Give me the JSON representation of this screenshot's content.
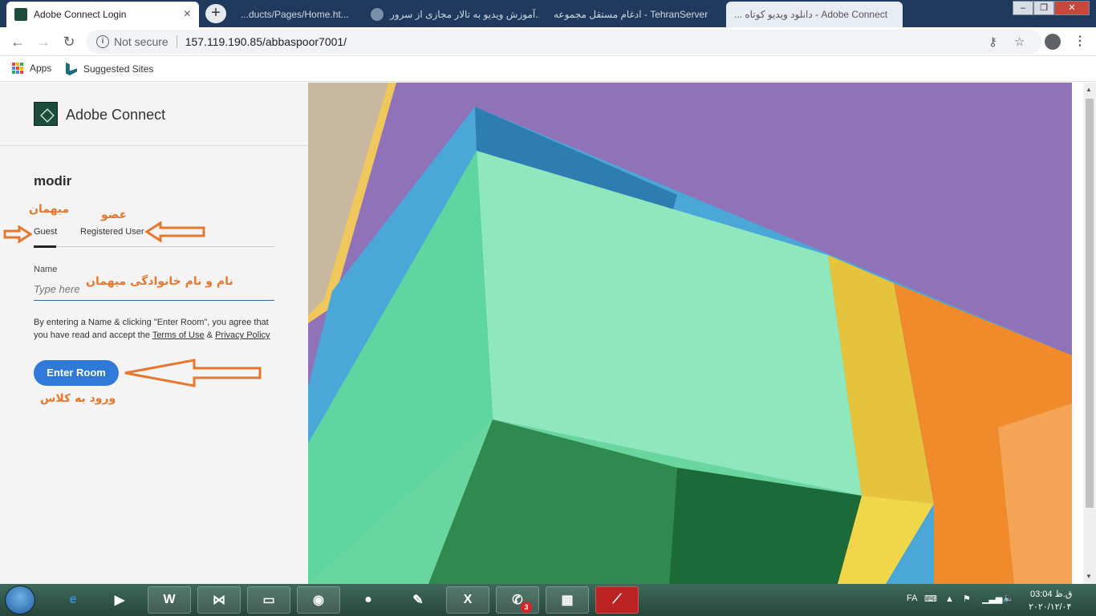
{
  "browser": {
    "active_tab_title": "Adobe Connect Login",
    "other_tabs": [
      "...ducts/Pages/Home.ht...",
      "آموزش ویدیو به تالار مجازی از سرور...",
      "ادغام مستقل مجموعه - TehranServer",
      "... دانلود ویدیو کوتاه - Adobe Connect"
    ],
    "new_tab": "+",
    "security_label": "Not secure",
    "url": "157.119.190.85/abbaspoor7001/",
    "window_controls": [
      "–",
      "❐",
      "✕"
    ]
  },
  "bookmarks": {
    "apps": "Apps",
    "suggested": "Suggested Sites"
  },
  "brand": {
    "title": "Adobe Connect"
  },
  "login": {
    "room_name": "modir",
    "tab_guest": "Guest",
    "tab_registered": "Registered User",
    "name_label": "Name",
    "name_placeholder": "Type here",
    "terms_prefix": "By entering a Name & clicking \"Enter Room\", you agree that you have read and accept the",
    "terms_link": "Terms of Use",
    "terms_and": "&",
    "privacy_link": "Privacy Policy",
    "enter_button": "Enter Room"
  },
  "annotations": {
    "guest": "میهمان",
    "member": "عضو",
    "guest_fullname": "نام و نام خانوادگی میهمان",
    "enter_class": "ورود به کلاس"
  },
  "taskbar": {
    "whatsapp_badge": "3",
    "language": "FA",
    "time": "03:04 ق.ظ",
    "date": "۲۰۲۰/۱۲/۰۴"
  },
  "colors": {
    "accent": "#2f79d8",
    "annotation": "#e8772e"
  }
}
